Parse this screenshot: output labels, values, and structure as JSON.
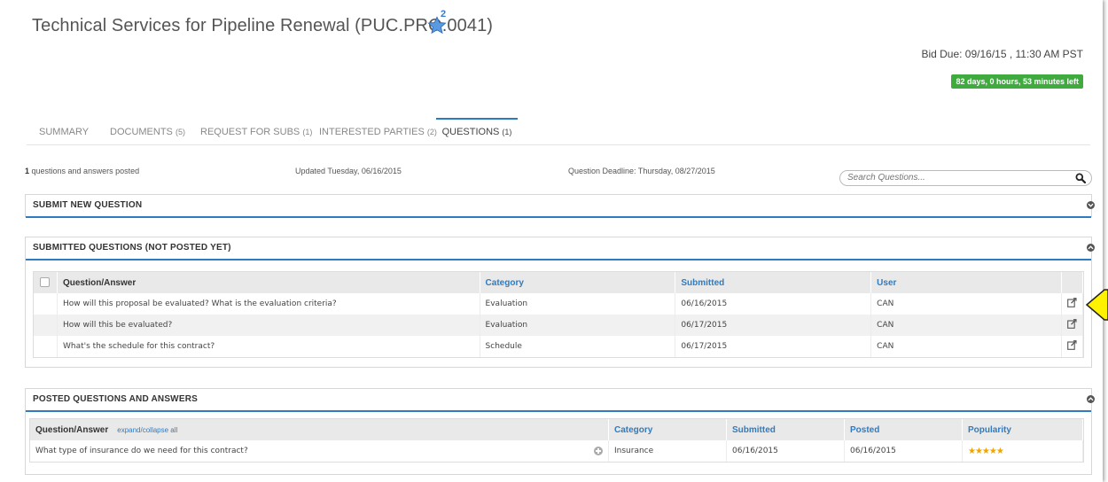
{
  "header": {
    "title": "Technical Services for Pipeline Renewal (PUC.PRO.0041)",
    "star_count": "2",
    "bid_due": "Bid Due:  09/16/15 , 11:30 AM PST",
    "time_left": "82 days, 0 hours, 53 minutes left"
  },
  "tabs": [
    {
      "label": "SUMMARY",
      "count": ""
    },
    {
      "label": "DOCUMENTS",
      "count": "(5)"
    },
    {
      "label": "REQUEST FOR SUBS",
      "count": "(1)"
    },
    {
      "label": "INTERESTED PARTIES",
      "count": "(2)"
    },
    {
      "label": "QUESTIONS",
      "count": "(1)"
    }
  ],
  "info": {
    "posted_count": "1",
    "posted_text": " questions and answers posted",
    "updated": "Updated  Tuesday, 06/16/2015",
    "deadline": "Question Deadline: Thursday, 08/27/2015",
    "search_placeholder": "Search Questions..."
  },
  "submit_panel": {
    "title": "SUBMIT NEW QUESTION"
  },
  "submitted_panel": {
    "title": "SUBMITTED QUESTIONS (NOT POSTED YET)",
    "columns": [
      "Question/Answer",
      "Category",
      "Submitted",
      "User"
    ],
    "rows": [
      {
        "question": "How will this proposal be evaluated? What is the evaluation criteria?",
        "category": "Evaluation",
        "submitted": "06/16/2015",
        "user": "CAN"
      },
      {
        "question": "How will this be evaluated?",
        "category": "Evaluation",
        "submitted": "06/17/2015",
        "user": "CAN"
      },
      {
        "question": "What's the schedule for this contract?",
        "category": "Schedule",
        "submitted": "06/17/2015",
        "user": "CAN"
      }
    ]
  },
  "posted_panel": {
    "title": "POSTED QUESTIONS AND ANSWERS",
    "expand_label": "expand/collapse all",
    "columns": [
      "Question/Answer",
      "Category",
      "Submitted",
      "Posted",
      "Popularity"
    ],
    "rows": [
      {
        "question": "What type of insurance do we need for this contract?",
        "category": "Insurance",
        "submitted": "06/16/2015",
        "posted": "06/16/2015",
        "stars": "★★★★★"
      }
    ]
  },
  "colors": {
    "accent": "#2f7bc1",
    "success": "#3fab3f",
    "star": "#f0a400",
    "pointer": "#fff200"
  },
  "icons": [
    "star-icon",
    "search-icon",
    "chevron-down-icon",
    "chevron-up-icon",
    "edit-icon",
    "plus-icon",
    "pointer-arrow"
  ]
}
